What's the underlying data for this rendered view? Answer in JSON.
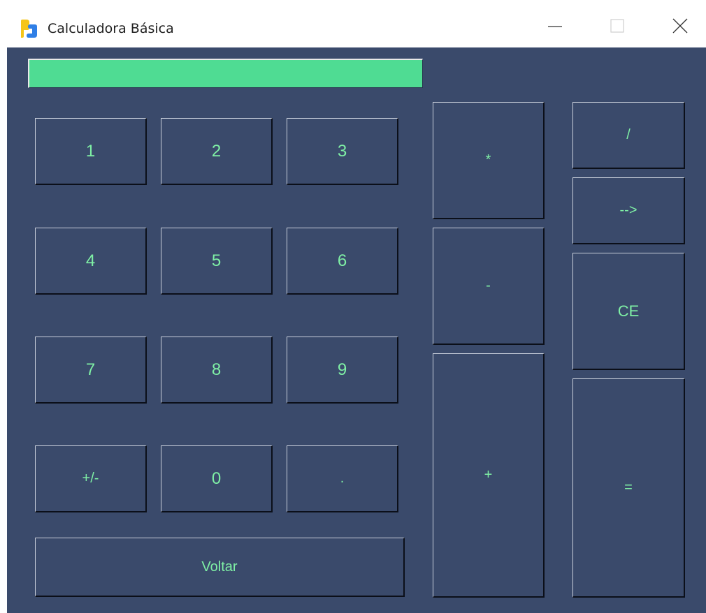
{
  "window": {
    "title": "Calculadora Básica",
    "controls": {
      "minimize": "minimize",
      "maximize": "maximize",
      "close": "close"
    }
  },
  "display": {
    "value": ""
  },
  "keys": {
    "one": "1",
    "two": "2",
    "three": "3",
    "four": "4",
    "five": "5",
    "six": "6",
    "seven": "7",
    "eight": "8",
    "nine": "9",
    "zero": "0",
    "sign": "+/-",
    "decimal": ".",
    "back": "Voltar",
    "multiply": "*",
    "subtract": "-",
    "add": "+",
    "divide": "/",
    "backspace": "-->",
    "clear": "CE",
    "equals": "="
  },
  "colors": {
    "background": "#3a4a6b",
    "display": "#4fdc93",
    "key_text": "#7ff0a5",
    "icon_blue": "#2f7fe6",
    "icon_yellow": "#f5c518"
  }
}
